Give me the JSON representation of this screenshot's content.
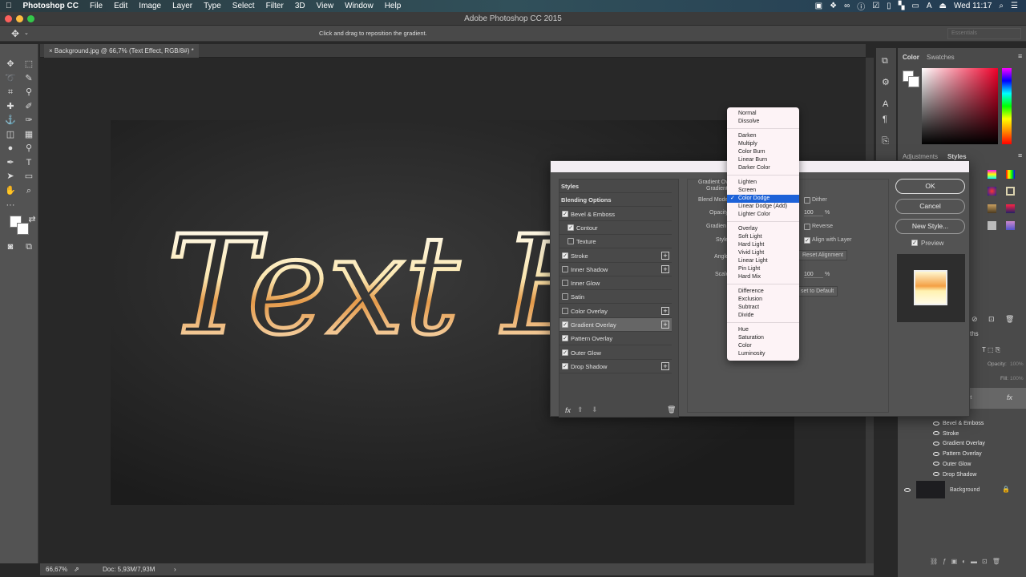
{
  "menubar": {
    "app": "Photoshop CC",
    "items": [
      "File",
      "Edit",
      "Image",
      "Layer",
      "Type",
      "Select",
      "Filter",
      "3D",
      "View",
      "Window",
      "Help"
    ],
    "clock": "Wed 11:17"
  },
  "window": {
    "title": "Adobe Photoshop CC 2015"
  },
  "options_bar": {
    "hint": "Click and drag to reposition the gradient.",
    "workspace": "Essentials"
  },
  "document": {
    "tab": "Background.jpg @ 66,7% (Text Effect, RGB/8#) *",
    "canvas_text": "Text Eff"
  },
  "status": {
    "zoom": "66,67%",
    "doc": "Doc: 5,93M/7,93M"
  },
  "panels": {
    "color_tabs": [
      "Color",
      "Swatches"
    ],
    "adjust_tabs": [
      "Adjustments",
      "Styles"
    ],
    "layers_tab_partial": "ths",
    "opacity_label": "Opacity:",
    "opacity_value": "100%",
    "fill_label": "Fill:",
    "fill_value": "100%",
    "layer_partial": "ect",
    "fx": "fx"
  },
  "layers": {
    "effects": [
      "Bevel & Emboss",
      "Stroke",
      "Gradient Overlay",
      "Pattern Overlay",
      "Outer Glow",
      "Drop Shadow"
    ],
    "background": "Background"
  },
  "dialog": {
    "styles": [
      {
        "label": "Styles",
        "cb": null,
        "indent": 0,
        "plus": false
      },
      {
        "label": "Blending Options",
        "cb": null,
        "indent": 0,
        "plus": false
      },
      {
        "label": "Bevel & Emboss",
        "cb": true,
        "indent": 0,
        "plus": false
      },
      {
        "label": "Contour",
        "cb": true,
        "indent": 1,
        "plus": false
      },
      {
        "label": "Texture",
        "cb": false,
        "indent": 1,
        "plus": false
      },
      {
        "label": "Stroke",
        "cb": true,
        "indent": 0,
        "plus": true
      },
      {
        "label": "Inner Shadow",
        "cb": false,
        "indent": 0,
        "plus": true
      },
      {
        "label": "Inner Glow",
        "cb": false,
        "indent": 0,
        "plus": false
      },
      {
        "label": "Satin",
        "cb": false,
        "indent": 0,
        "plus": false
      },
      {
        "label": "Color Overlay",
        "cb": false,
        "indent": 0,
        "plus": true
      },
      {
        "label": "Gradient Overlay",
        "cb": true,
        "indent": 0,
        "plus": true,
        "selected": true
      },
      {
        "label": "Pattern Overlay",
        "cb": true,
        "indent": 0,
        "plus": false
      },
      {
        "label": "Outer Glow",
        "cb": true,
        "indent": 0,
        "plus": false
      },
      {
        "label": "Drop Shadow",
        "cb": true,
        "indent": 0,
        "plus": true
      }
    ],
    "section_title": "Gradient Ov",
    "section_sub": "Gradient",
    "labels": {
      "blend": "Blend Mode",
      "opacity": "Opacity",
      "gradient": "Gradien",
      "style": "Style",
      "angle": "Angle",
      "scale": "Scale"
    },
    "dither": "Dither",
    "opacity_value": "100",
    "pct": "%",
    "reverse": "Reverse",
    "align": "Align with Layer",
    "reset_alignment": "Reset Alignment",
    "scale_value": "100",
    "reset_default": "set to Default",
    "buttons": {
      "ok": "OK",
      "cancel": "Cancel",
      "new_style": "New Style...",
      "preview": "Preview"
    }
  },
  "blend_menu": {
    "selected": "Color Dodge",
    "groups": [
      [
        "Normal",
        "Dissolve"
      ],
      [
        "Darken",
        "Multiply",
        "Color Burn",
        "Linear Burn",
        "Darker Color"
      ],
      [
        "Lighten",
        "Screen",
        "Color Dodge",
        "Linear Dodge (Add)",
        "Lighter Color"
      ],
      [
        "Overlay",
        "Soft Light",
        "Hard Light",
        "Vivid Light",
        "Linear Light",
        "Pin Light",
        "Hard Mix"
      ],
      [
        "Difference",
        "Exclusion",
        "Subtract",
        "Divide"
      ],
      [
        "Hue",
        "Saturation",
        "Color",
        "Luminosity"
      ]
    ]
  }
}
